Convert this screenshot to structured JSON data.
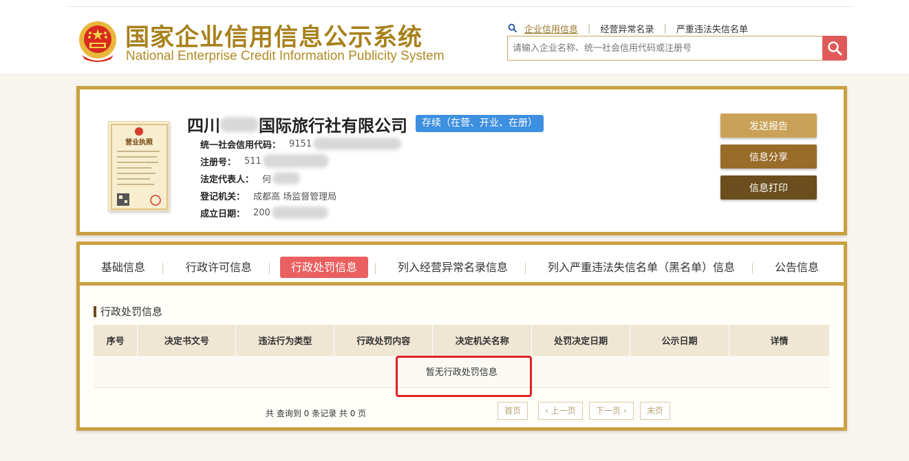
{
  "header": {
    "title": "国家企业信用信息公示系统",
    "subtitle": "National Enterprise Credit Information Publicity System",
    "search_links": {
      "enterprise_credit": "企业信用信息",
      "abnormal_list": "经营异常名录",
      "serious_violation": "严重违法失信名单"
    },
    "search_placeholder": "请输入企业名称、统一社会信用代码或注册号"
  },
  "company": {
    "name_prefix": "四川",
    "name_suffix": "国际旅行社有限公司",
    "status": "存续（在营、开业、在册）",
    "fields": [
      {
        "label": "统一社会信用代码：",
        "value": "9151"
      },
      {
        "label": "注册号：",
        "value": "511"
      },
      {
        "label": "法定代表人：",
        "value": "何"
      },
      {
        "label": "登记机关：",
        "value": "成都高          场监督管理局"
      },
      {
        "label": "成立日期：",
        "value": "200"
      }
    ],
    "license_label": "营业执照",
    "buttons": {
      "report": "发送报告",
      "share": "信息分享",
      "print": "信息打印"
    }
  },
  "tabs": [
    {
      "label": "基础信息",
      "active": false
    },
    {
      "label": "行政许可信息",
      "active": false
    },
    {
      "label": "行政处罚信息",
      "active": true
    },
    {
      "label": "列入经营异常名录信息",
      "active": false
    },
    {
      "label": "列入严重违法失信名单（黑名单）信息",
      "active": false
    },
    {
      "label": "公告信息",
      "active": false
    }
  ],
  "section": {
    "title": "行政处罚信息",
    "columns": [
      "序号",
      "决定书文号",
      "违法行为类型",
      "行政处罚内容",
      "决定机关名称",
      "处罚决定日期",
      "公示日期",
      "详情"
    ],
    "empty_text": "暂无行政处罚信息"
  },
  "pager": {
    "info": "共 查询到 0 条记录 共 0 页",
    "first": "首页",
    "prev": "上一页",
    "next": "下一页",
    "last": "末页"
  },
  "colors": {
    "gold": "#c9a141",
    "active_tab": "#ea5f5f",
    "status_badge": "#3d8fe0",
    "highlight": "#e02020"
  }
}
